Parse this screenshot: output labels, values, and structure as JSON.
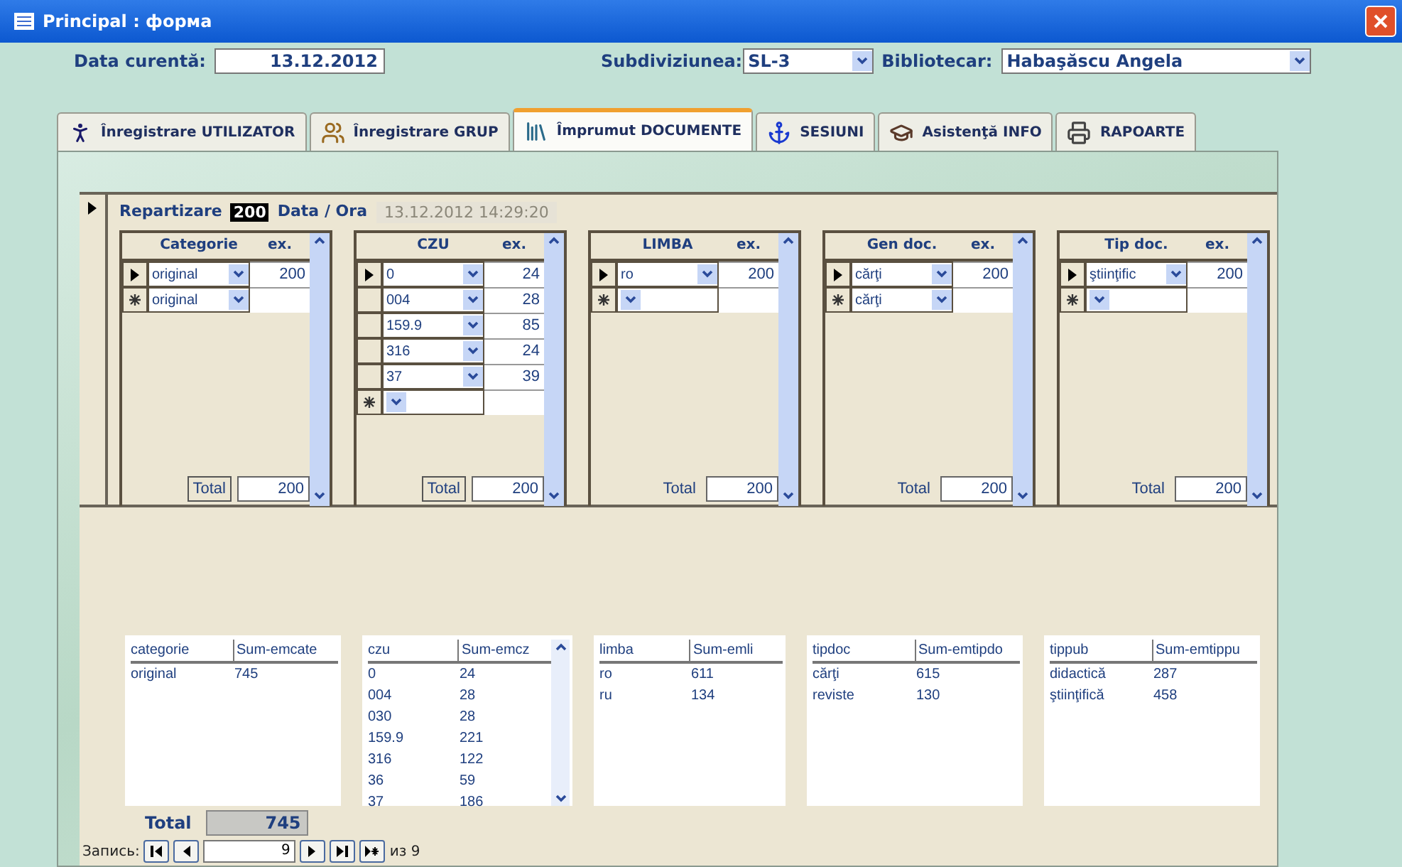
{
  "window": {
    "title": "Principal : форма"
  },
  "header": {
    "date": {
      "label": "Data curentă:",
      "value": "13.12.2012"
    },
    "subdivision": {
      "label": "Subdiviziunea:",
      "value": "SL-3"
    },
    "librarian": {
      "label": "Bibliotecar:",
      "value": "Habaşăscu Angela"
    }
  },
  "tabs": [
    {
      "label": "Înregistrare UTILIZATOR",
      "selected": false
    },
    {
      "label": "Înregistrare GRUP",
      "selected": false
    },
    {
      "label": "Împrumut DOCUMENTE",
      "selected": true
    },
    {
      "label": "SESIUNI",
      "selected": false
    },
    {
      "label": "Asistenţă INFO",
      "selected": false
    },
    {
      "label": "RAPOARTE",
      "selected": false
    }
  ],
  "form": {
    "distribution": {
      "label": "Repartizare",
      "value": "200",
      "highlighted": true
    },
    "datetime": {
      "label": "Data / Ora",
      "value": "13.12.2012 14:29:20",
      "disabled": true
    },
    "subforms": [
      {
        "columns": [
          "Categorie",
          "ex."
        ],
        "rows": [
          {
            "kind": "current",
            "value": "original",
            "count": "200"
          },
          {
            "kind": "new",
            "value": "original"
          }
        ],
        "total_label": "Total",
        "total_boxed": true,
        "total": "200"
      },
      {
        "columns": [
          "CZU",
          "ex."
        ],
        "rows": [
          {
            "kind": "current",
            "value": "0",
            "count": "24"
          },
          {
            "kind": "plain",
            "value": "004",
            "count": "28"
          },
          {
            "kind": "plain",
            "value": "159.9",
            "count": "85"
          },
          {
            "kind": "plain",
            "value": "316",
            "count": "24"
          },
          {
            "kind": "plain",
            "value": "37",
            "count": "39"
          },
          {
            "kind": "new"
          }
        ],
        "total_label": "Total",
        "total_boxed": true,
        "total": "200"
      },
      {
        "columns": [
          "LIMBA",
          "ex."
        ],
        "rows": [
          {
            "kind": "current",
            "value": "ro",
            "count": "200"
          },
          {
            "kind": "new"
          }
        ],
        "total_label": "Total",
        "total_boxed": false,
        "total": "200"
      },
      {
        "columns": [
          "Gen doc.",
          "ex."
        ],
        "rows": [
          {
            "kind": "current",
            "value": "cărţi",
            "count": "200"
          },
          {
            "kind": "new",
            "value": "cărţi"
          }
        ],
        "total_label": "Total",
        "total_boxed": false,
        "total": "200"
      },
      {
        "columns": [
          "Tip doc.",
          "ex."
        ],
        "rows": [
          {
            "kind": "current",
            "value": "ştiinţific",
            "count": "200"
          },
          {
            "kind": "new"
          }
        ],
        "total_label": "Total",
        "total_boxed": false,
        "total": "200"
      }
    ],
    "lists": [
      {
        "columns": [
          "categorie",
          "Sum-emcate"
        ],
        "rows": [
          [
            "original",
            "745"
          ]
        ],
        "scrollable": false
      },
      {
        "columns": [
          "czu",
          "Sum-emcz"
        ],
        "rows": [
          [
            "0",
            "24"
          ],
          [
            "004",
            "28"
          ],
          [
            "030",
            "28"
          ],
          [
            "159.9",
            "221"
          ],
          [
            "316",
            "122"
          ],
          [
            "36",
            "59"
          ],
          [
            "37",
            "186"
          ]
        ],
        "scrollable": true
      },
      {
        "columns": [
          "limba",
          "Sum-emli"
        ],
        "rows": [
          [
            "ro",
            "611"
          ],
          [
            "ru",
            "134"
          ]
        ],
        "scrollable": false
      },
      {
        "columns": [
          "tipdoc",
          "Sum-emtipdo"
        ],
        "rows": [
          [
            "cărţi",
            "615"
          ],
          [
            "reviste",
            "130"
          ]
        ],
        "scrollable": false
      },
      {
        "columns": [
          "tippub",
          "Sum-emtippu"
        ],
        "rows": [
          [
            "didactică",
            "287"
          ],
          [
            "ştiinţifică",
            "458"
          ]
        ],
        "scrollable": false
      }
    ],
    "total": {
      "label": "Total",
      "value": "745"
    }
  },
  "navigation": {
    "label": "Запись:",
    "value": "9",
    "of": "из 9"
  }
}
